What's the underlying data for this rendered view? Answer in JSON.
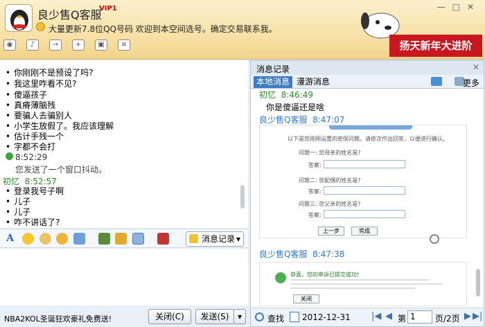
{
  "window": {
    "title": "良少售Q客服",
    "vip_badge": "VIP1",
    "signature": "大量更新7.8位QQ号码  欢迎到本空间选号。确定交易联系我。",
    "banner": "扬天新年大进阶"
  },
  "chat": {
    "lines": [
      "你刚刚不是预设了吗?",
      "我这里咋看不见?",
      "傻逼孩子",
      "真瘠薄脑残",
      "要骗人去骗别人",
      "小学生放假了。我应该理解",
      "估计手残一个",
      "字都不会打"
    ],
    "shake_time": "8:52:29",
    "shake_text": "您发送了一个窗口抖动。",
    "sender2_name": "初忆",
    "sender2_time": "8:52:57",
    "lines2": [
      "登录我号子啊",
      "儿子",
      "儿子",
      "咋不讲话了?"
    ]
  },
  "format_bar": {
    "history_label": "消息记录"
  },
  "bottom": {
    "promo": "NBA2KOL圣诞狂欢豪礼免费送!",
    "close_label": "关闭(C)",
    "send_label": "发送(S)"
  },
  "history": {
    "title": "消息记录",
    "tab_local": "本地消息",
    "tab_roam": "漫游消息",
    "more_label": "更多",
    "msg1_name": "初忆",
    "msg1_time": "8:46:49",
    "msg1_text": "你是傻逼还是啥",
    "msg2_name": "良少售Q客服",
    "msg2_time": "8:47:07",
    "msg3_name": "良少售Q客服",
    "msg3_time": "8:47:38",
    "shot1": {
      "intro": "以下是您刚刚设置的密保问题。请依次作出回答，以便进行确认。",
      "q1": "问题一: 您母亲的姓名是?",
      "q2": "问题二: 您配偶的姓名是?",
      "q3": "问题三: 您父亲的姓名是?",
      "answer_label": "答案:",
      "prev_label": "上一步",
      "done_label": "完成"
    },
    "shot2": {
      "heading": "恭喜，您的申诉已提交成功!",
      "button": "关闭"
    },
    "search_label": "查找",
    "date": "2012-12-31",
    "page_prefix": "第",
    "page_number": "1",
    "page_suffix": "页/2页"
  }
}
